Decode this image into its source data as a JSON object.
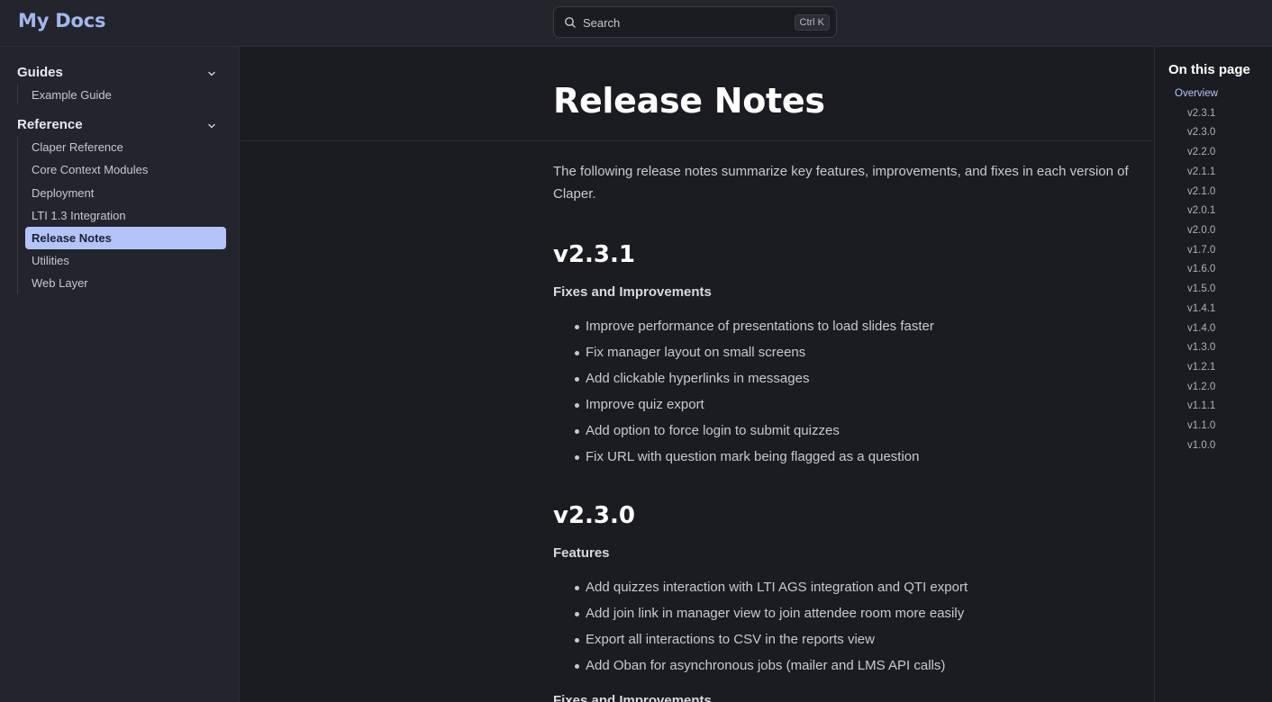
{
  "header": {
    "brand": "My Docs",
    "search": {
      "label": "Search",
      "shortcut": "Ctrl K"
    }
  },
  "sidebar": {
    "groups": [
      {
        "title": "Guides",
        "items": [
          "Example Guide"
        ]
      },
      {
        "title": "Reference",
        "items": [
          "Claper Reference",
          "Core Context Modules",
          "Deployment",
          "LTI 1.3 Integration",
          "Release Notes",
          "Utilities",
          "Web Layer"
        ]
      }
    ],
    "active_item": "Release Notes"
  },
  "main": {
    "title": "Release Notes",
    "intro": "The following release notes summarize key features, improvements, and fixes in each version of Claper.",
    "sections": [
      {
        "version": "v2.3.1",
        "subsections": [
          {
            "heading": "Fixes and Improvements",
            "items": [
              "Improve performance of presentations to load slides faster",
              "Fix manager layout on small screens",
              "Add clickable hyperlinks in messages",
              "Improve quiz export",
              "Add option to force login to submit quizzes",
              "Fix URL with question mark being flagged as a question"
            ]
          }
        ]
      },
      {
        "version": "v2.3.0",
        "subsections": [
          {
            "heading": "Features",
            "items": [
              "Add quizzes interaction with LTI AGS integration and QTI export",
              "Add join link in manager view to join attendee room more easily",
              "Export all interactions to CSV in the reports view",
              "Add Oban for asynchronous jobs (mailer and LMS API calls)"
            ]
          },
          {
            "heading": "Fixes and Improvements",
            "items": []
          }
        ]
      }
    ]
  },
  "toc": {
    "title": "On this page",
    "overview": "Overview",
    "items": [
      "v2.3.1",
      "v2.3.0",
      "v2.2.0",
      "v2.1.1",
      "v2.1.0",
      "v2.0.1",
      "v2.0.0",
      "v1.7.0",
      "v1.6.0",
      "v1.5.0",
      "v1.4.1",
      "v1.4.0",
      "v1.3.0",
      "v1.2.1",
      "v1.2.0",
      "v1.1.1",
      "v1.1.0",
      "v1.0.0"
    ]
  },
  "colors": {
    "accent": "#a4b6ec",
    "active_bg": "#b4c4f8",
    "background": "#1b1c21",
    "panel": "#23252d"
  },
  "icons": {
    "search": "search-icon",
    "chevron": "chevron-down-icon"
  }
}
